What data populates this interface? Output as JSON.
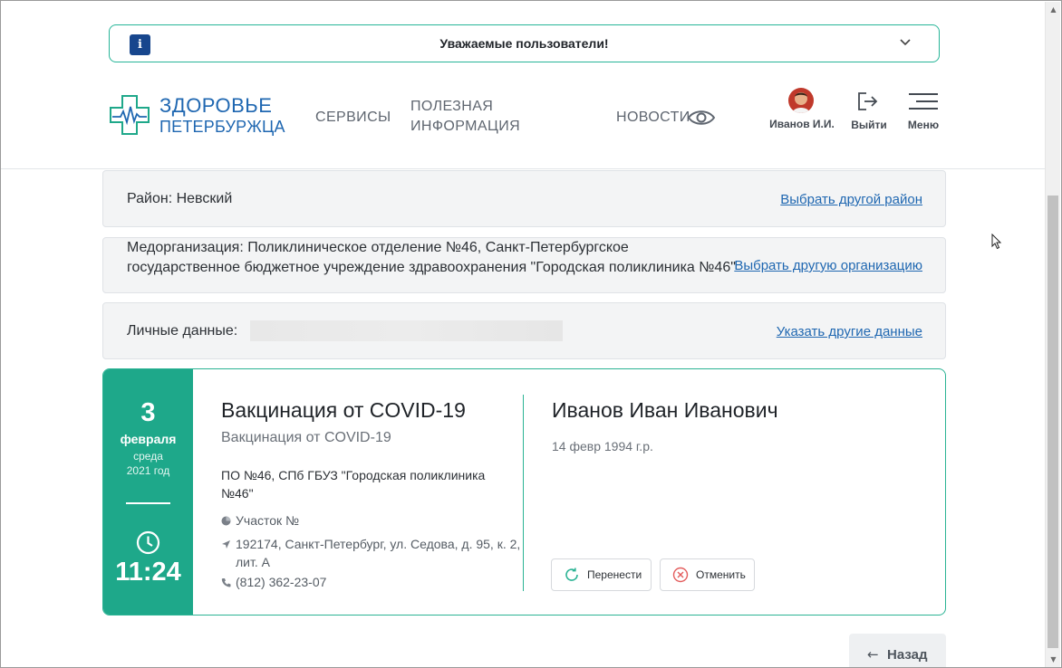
{
  "notice": {
    "icon": "info-icon",
    "icon_glyph": "i",
    "text": "Уважаемые пользователи!",
    "chevron": "chevron-down-icon"
  },
  "header": {
    "logo_line1": "ЗДОРОВЬЕ",
    "logo_line2": "ПЕТЕРБУРЖЦА",
    "nav": {
      "services": "СЕРВИСЫ",
      "info": "ПОЛЕЗНАЯ ИНФОРМАЦИЯ",
      "news": "НОВОСТИ"
    },
    "user_name": "Иванов И.И.",
    "logout_label": "Выйти",
    "menu_label": "Меню"
  },
  "district": {
    "label": "Район: Невский",
    "link": "Выбрать другой район"
  },
  "organization": {
    "label": "Медорганизация: Поликлиническое отделение №46, Санкт-Петербургское государственное бюджетное учреждение здравоохранения \"Городская поликлиника №46\"",
    "link": "Выбрать другую организацию"
  },
  "personal": {
    "label": "Личные данные:",
    "link": "Указать другие данные"
  },
  "appointment": {
    "day": "3",
    "month": "февраля",
    "weekday": "среда",
    "year": "2021 год",
    "time": "11:24",
    "service_title": "Вакцинация от COVID-19",
    "service_subtitle": "Вакцинация от COVID-19",
    "org_short": "ПО №46, СПб ГБУЗ \"Городская поликлиника №46\"",
    "area": "Участок №",
    "address": "192174, Санкт-Петербург, ул. Седова, д. 95, к. 2, лит. А",
    "phone": "(812) 362-23-07",
    "patient_name": "Иванов Иван Иванович",
    "patient_dob": "14 февр 1994 г.р.",
    "reschedule_label": "Перенести",
    "cancel_label": "Отменить"
  },
  "back_label": "Назад",
  "colors": {
    "accent_green": "#1ea88a",
    "brand_blue": "#1f67b1",
    "notice_icon_bg": "#17468d"
  }
}
